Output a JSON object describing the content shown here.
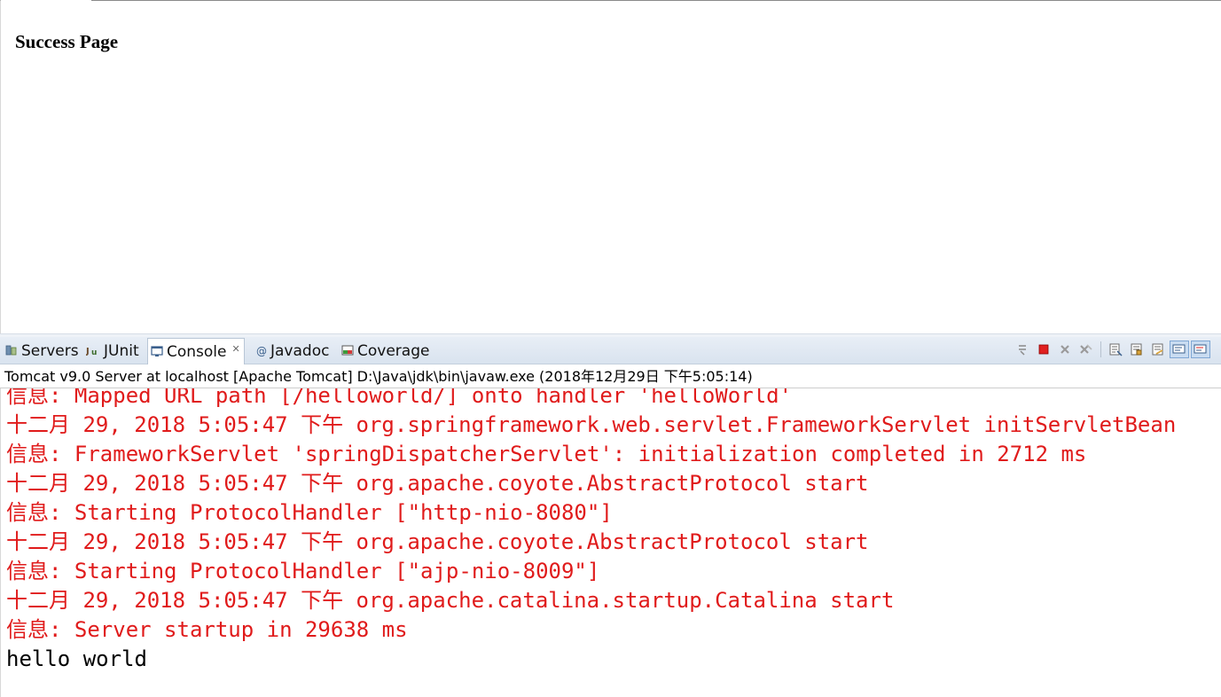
{
  "browser": {
    "heading": "Success Page"
  },
  "views": {
    "tabs": [
      {
        "label": "Servers",
        "icon": "servers-icon",
        "active": false
      },
      {
        "label": "JUnit",
        "icon": "junit-icon",
        "active": false
      },
      {
        "label": "Console",
        "icon": "console-icon",
        "active": true
      },
      {
        "label": "Javadoc",
        "icon": "javadoc-icon",
        "active": false
      },
      {
        "label": "Coverage",
        "icon": "coverage-icon",
        "active": false
      }
    ],
    "close_glyph": "✕",
    "toolbar": [
      "pin-icon",
      "terminate-icon",
      "remove-launch-icon",
      "remove-all-terminated-icon",
      "clear-console-icon",
      "scroll-lock-icon",
      "word-wrap-icon",
      "show-on-stdout-icon",
      "show-on-stderr-icon"
    ]
  },
  "console": {
    "header": "Tomcat v9.0 Server at localhost [Apache Tomcat] D:\\Java\\jdk\\bin\\javaw.exe (2018年12月29日 下午5:05:14)",
    "lines": [
      {
        "text": "信息: Mapped URL path [/helloworld/] onto handler 'helloWorld'",
        "stream": "err"
      },
      {
        "text": "十二月 29, 2018 5:05:47 下午 org.springframework.web.servlet.FrameworkServlet initServletBean",
        "stream": "err"
      },
      {
        "text": "信息: FrameworkServlet 'springDispatcherServlet': initialization completed in 2712 ms",
        "stream": "err"
      },
      {
        "text": "十二月 29, 2018 5:05:47 下午 org.apache.coyote.AbstractProtocol start",
        "stream": "err"
      },
      {
        "text": "信息: Starting ProtocolHandler [\"http-nio-8080\"]",
        "stream": "err"
      },
      {
        "text": "十二月 29, 2018 5:05:47 下午 org.apache.coyote.AbstractProtocol start",
        "stream": "err"
      },
      {
        "text": "信息: Starting ProtocolHandler [\"ajp-nio-8009\"]",
        "stream": "err"
      },
      {
        "text": "十二月 29, 2018 5:05:47 下午 org.apache.catalina.startup.Catalina start",
        "stream": "err"
      },
      {
        "text": "信息: Server startup in 29638 ms",
        "stream": "err"
      },
      {
        "text": "hello world",
        "stream": "out"
      }
    ]
  },
  "colors": {
    "stderr": "#e01b1b",
    "stdout": "#000000",
    "tabbar": "#dde6f1"
  }
}
